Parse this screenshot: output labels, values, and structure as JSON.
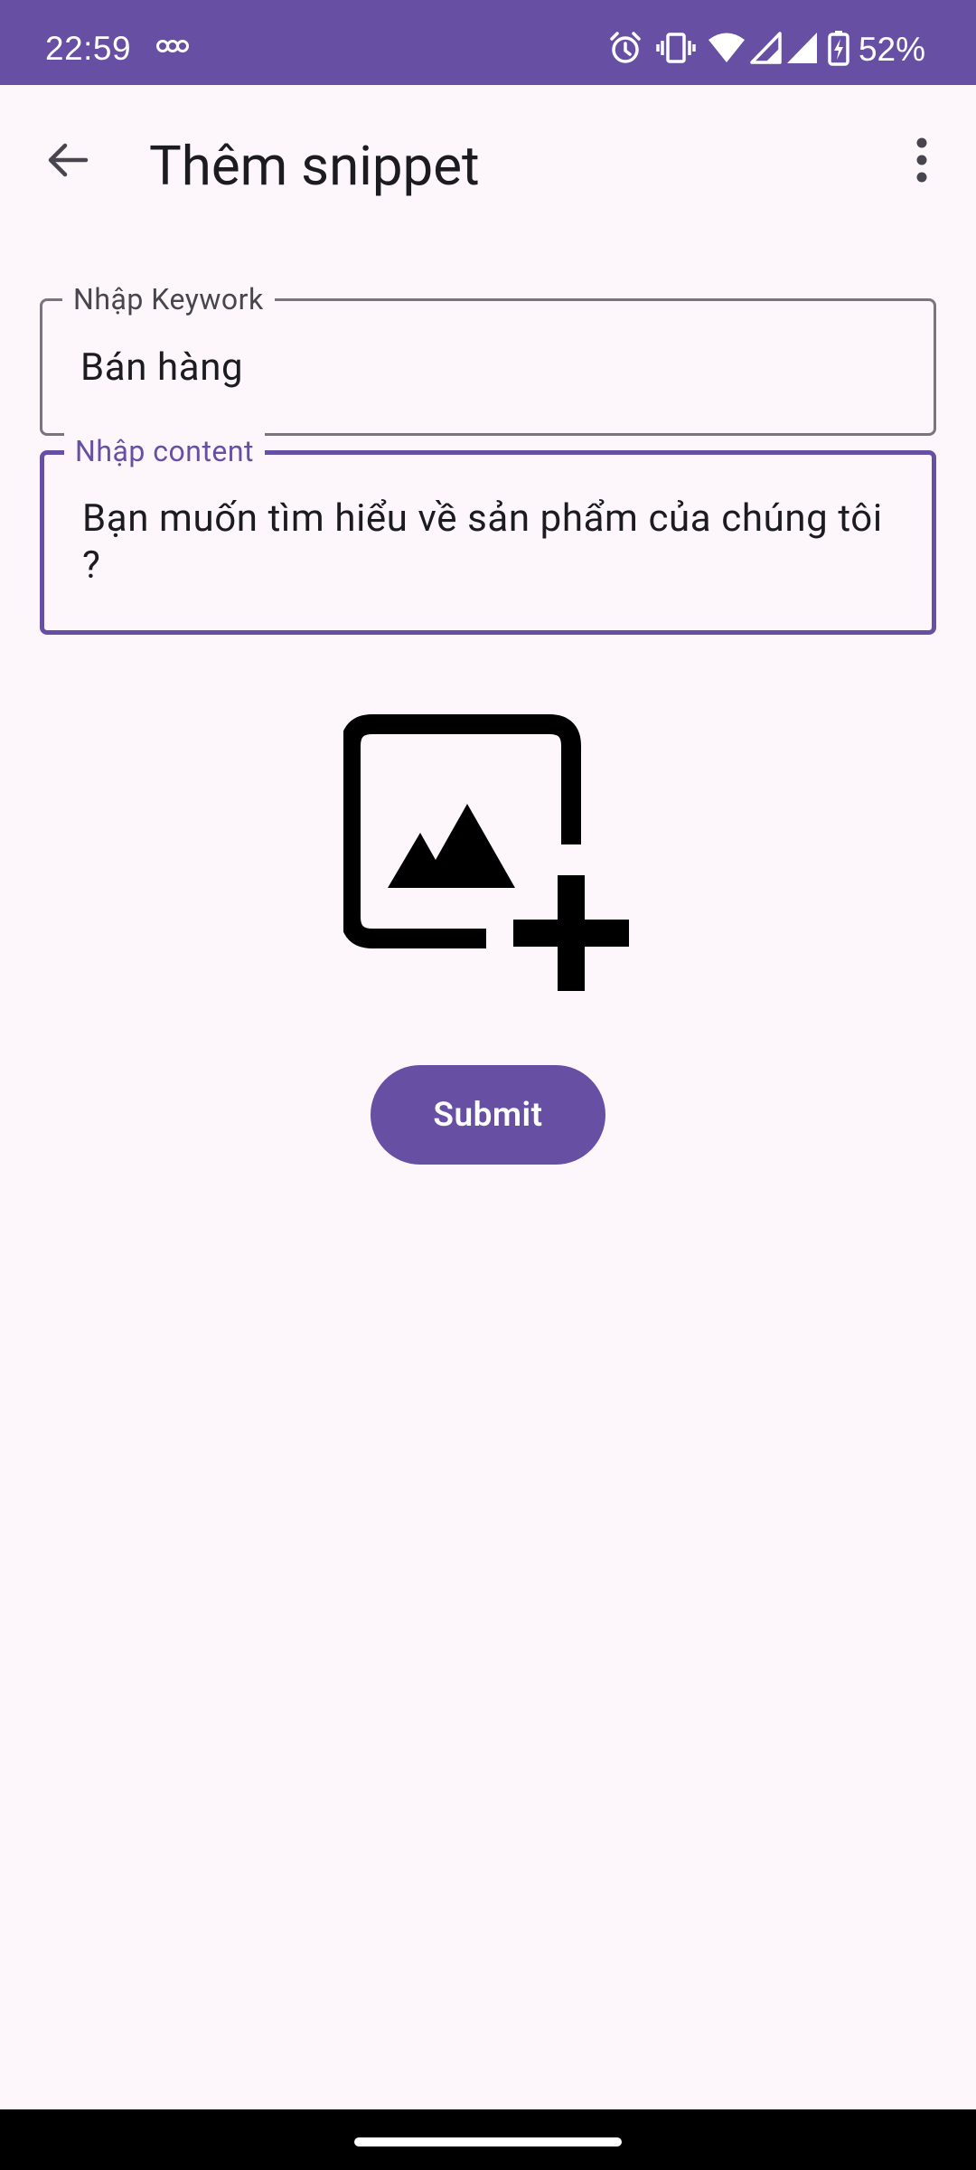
{
  "status_bar": {
    "time": "22:59",
    "battery_percent": "52%",
    "icons": [
      "link-icon",
      "alarm-icon",
      "vibrate-icon",
      "wifi-icon",
      "signal-icon",
      "signal-icon",
      "battery-charging-icon"
    ]
  },
  "app_bar": {
    "title": "Thêm snippet",
    "back_icon": "arrow-back-icon",
    "menu_icon": "more-vert-icon"
  },
  "form": {
    "keyword": {
      "label": "Nhập Keywork",
      "value": "Bán hàng"
    },
    "content": {
      "label": "Nhập content",
      "value": "Bạn muốn tìm hiểu về sản phẩm của chúng tôi ?"
    },
    "add_image_icon": "add-photo-icon",
    "submit_label": "Submit"
  },
  "colors": {
    "brand": "#6750a4",
    "accent": "#6750a4",
    "background": "#fdf7fc"
  }
}
